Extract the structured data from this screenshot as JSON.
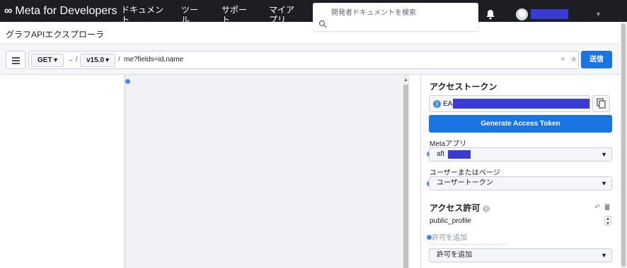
{
  "nav": {
    "logo_text": "Meta for Developers",
    "items": [
      "ドキュメント",
      "ツール",
      "サポート",
      "マイアプリ"
    ],
    "search_placeholder": "開発者ドキュメントを検索"
  },
  "page": {
    "title": "グラフAPIエクスプローラ"
  },
  "request": {
    "method": "GET",
    "arrow": "→ /",
    "version": "v15.0",
    "slash": "/",
    "path": "me?fields=id,name",
    "clear": "×",
    "submit_label": "送信"
  },
  "token": {
    "section_title": "アクセストークン",
    "value_prefix": "EA",
    "generate_label": "Generate Access Token"
  },
  "app": {
    "label": "Metaアプリ",
    "value": "aft"
  },
  "user_or_page": {
    "label": "ユーザーまたはページ",
    "value": "ユーザートークン"
  },
  "permissions": {
    "section_title": "アクセス許可",
    "items": [
      "public_profile"
    ],
    "add_placeholder": "許可を追加",
    "add_select_label": "許可を追加"
  },
  "colors": {
    "accent": "#1b74e4",
    "nav_bg": "#1c1e21",
    "redaction": "#3a3ad6"
  },
  "icons": [
    "meta-logo-icon",
    "search-icon",
    "bell-icon",
    "avatar-icon",
    "hamburger-icon",
    "star-icon",
    "info-icon",
    "copy-icon",
    "undo-icon",
    "trash-icon",
    "help-icon"
  ]
}
